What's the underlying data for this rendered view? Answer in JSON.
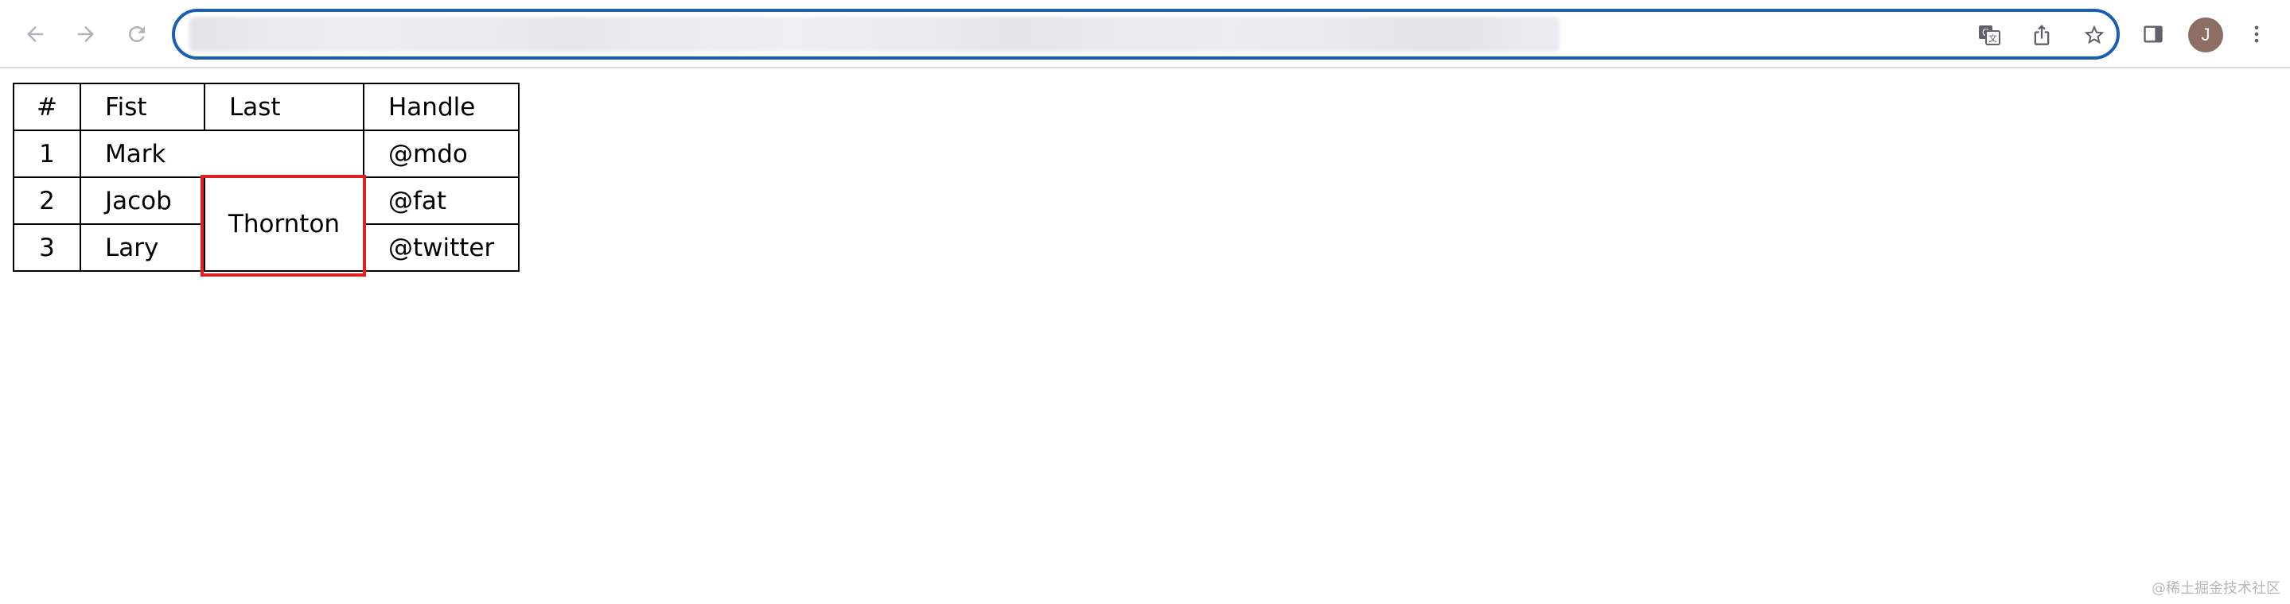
{
  "browser": {
    "back_icon": "arrow-left-icon",
    "forward_icon": "arrow-right-icon",
    "reload_icon": "reload-icon",
    "omnibox": {
      "url": "",
      "blurred": true
    },
    "omnibox_icons": [
      "translate-icon",
      "share-icon",
      "star-icon"
    ],
    "toolbar_icons": [
      "side-panel-icon",
      "avatar",
      "more-vert-icon"
    ],
    "avatar_initial": "J",
    "accent_color": "#1a5fb4",
    "avatar_color": "#8d6e63"
  },
  "table": {
    "headers": [
      "#",
      "Fist",
      "Last",
      "Handle"
    ],
    "rows": [
      {
        "num": "1",
        "first_last_merged": "Mark",
        "handle": "@mdo"
      },
      {
        "num": "2",
        "first": "Jacob",
        "last_merged": "Thornton",
        "handle": "@fat"
      },
      {
        "num": "3",
        "first": "Lary",
        "handle": "@twitter"
      }
    ],
    "highlight_color": "#e02020"
  },
  "watermark": "@稀土掘金技术社区"
}
